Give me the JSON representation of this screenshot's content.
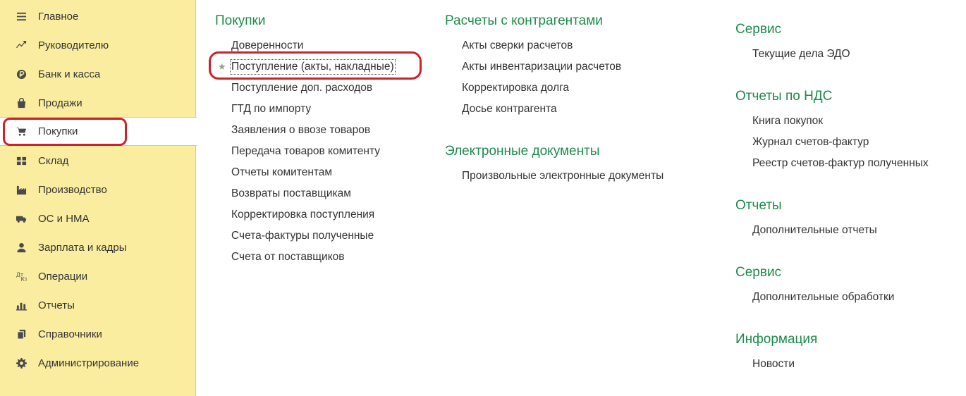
{
  "sidebar": {
    "items": [
      {
        "label": "Главное",
        "icon": "menu-icon"
      },
      {
        "label": "Руководителю",
        "icon": "trend-icon"
      },
      {
        "label": "Банк и касса",
        "icon": "ruble-icon"
      },
      {
        "label": "Продажи",
        "icon": "bag-icon"
      },
      {
        "label": "Покупки",
        "icon": "cart-icon",
        "active": true
      },
      {
        "label": "Склад",
        "icon": "warehouse-icon"
      },
      {
        "label": "Производство",
        "icon": "factory-icon"
      },
      {
        "label": "ОС и НМА",
        "icon": "truck-icon"
      },
      {
        "label": "Зарплата и кадры",
        "icon": "person-icon"
      },
      {
        "label": "Операции",
        "icon": "debit-credit-icon"
      },
      {
        "label": "Отчеты",
        "icon": "bar-chart-icon"
      },
      {
        "label": "Справочники",
        "icon": "books-icon"
      },
      {
        "label": "Администрирование",
        "icon": "gear-icon"
      }
    ]
  },
  "col1": {
    "title": "Покупки",
    "links": [
      "Доверенности",
      "Поступление (акты, накладные)",
      "Поступление доп. расходов",
      "ГТД по импорту",
      "Заявления о ввозе товаров",
      "Передача товаров комитенту",
      "Отчеты комитентам",
      "Возвраты поставщикам",
      "Корректировка поступления",
      "Счета-фактуры полученные",
      "Счета от поставщиков"
    ]
  },
  "col2": {
    "sections": [
      {
        "title": "Расчеты с контрагентами",
        "links": [
          "Акты сверки расчетов",
          "Акты инвентаризации расчетов",
          "Корректировка долга",
          "Досье контрагента"
        ]
      },
      {
        "title": "Электронные документы",
        "links": [
          "Произвольные электронные документы"
        ]
      }
    ]
  },
  "col3": {
    "sections": [
      {
        "title": "Сервис",
        "links": [
          "Текущие дела ЭДО"
        ]
      },
      {
        "title": "Отчеты по НДС",
        "links": [
          "Книга покупок",
          "Журнал счетов-фактур",
          "Реестр счетов-фактур полученных"
        ]
      },
      {
        "title": "Отчеты",
        "links": [
          "Дополнительные отчеты"
        ]
      },
      {
        "title": "Сервис",
        "links": [
          "Дополнительные обработки"
        ]
      },
      {
        "title": "Информация",
        "links": [
          "Новости"
        ]
      }
    ]
  },
  "colors": {
    "accent": "#1e8a4c",
    "sidebar_bg": "#fbeda0",
    "highlight": "#cc2229"
  }
}
